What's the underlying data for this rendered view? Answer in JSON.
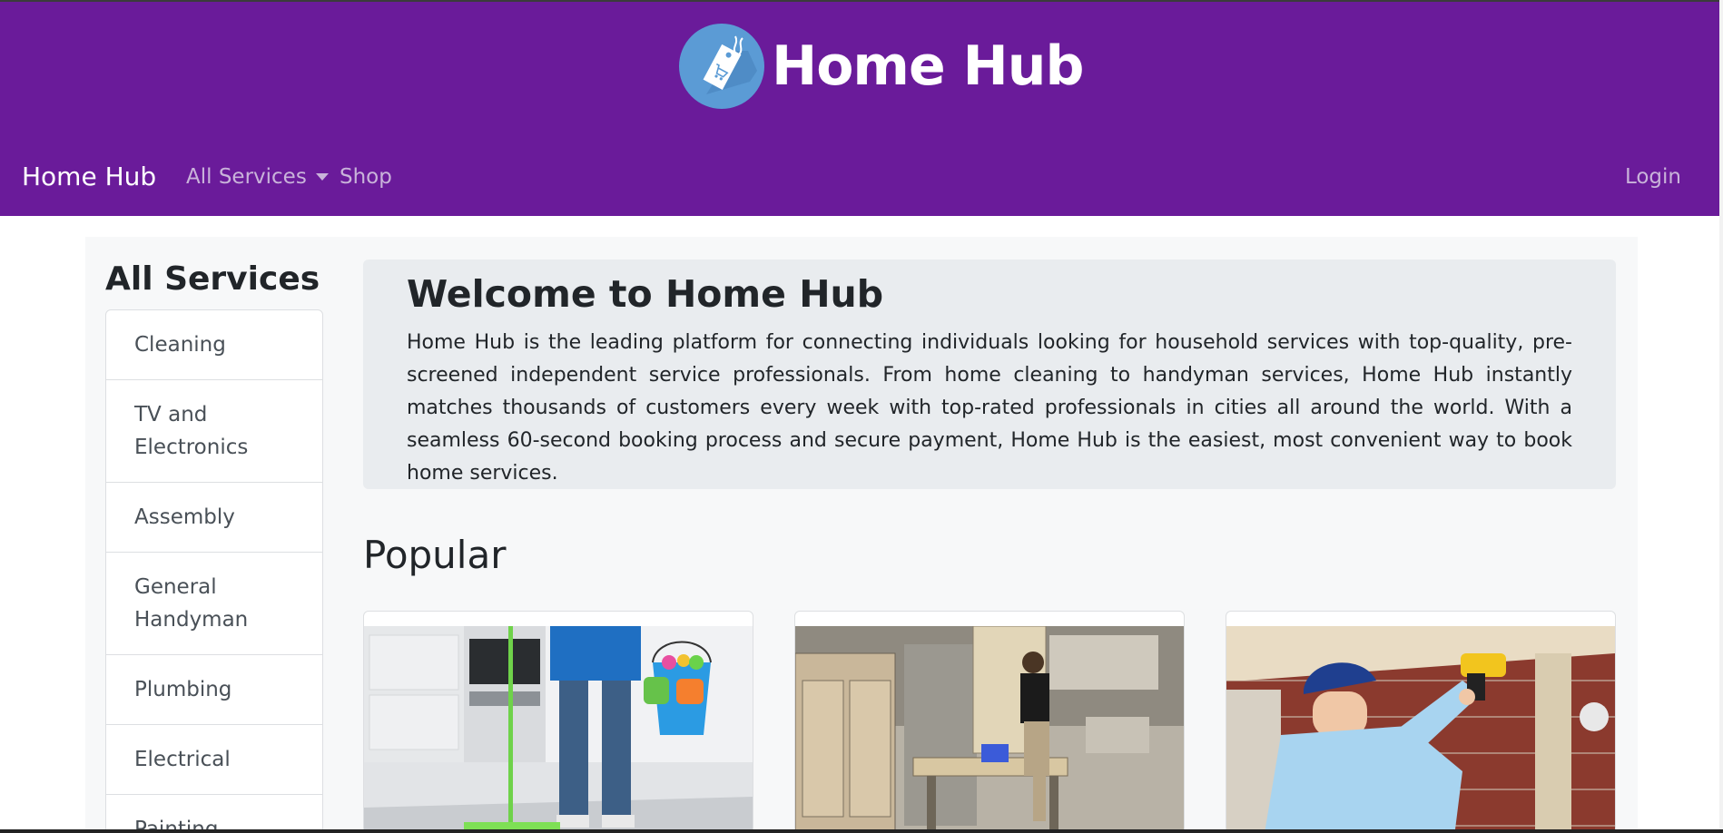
{
  "header": {
    "brand_title": "Home Hub",
    "logo_icon": "tag-cart-icon",
    "background_color": "#6a1b9a"
  },
  "navbar": {
    "brand": "Home Hub",
    "services_label": "All Services",
    "shop_label": "Shop",
    "login_label": "Login"
  },
  "sidebar": {
    "title": "All Services",
    "items": [
      {
        "label": "Cleaning"
      },
      {
        "label": "TV and Electronics"
      },
      {
        "label": "Assembly"
      },
      {
        "label": "General Handyman"
      },
      {
        "label": "Plumbing"
      },
      {
        "label": "Electrical"
      },
      {
        "label": "Painting"
      }
    ]
  },
  "welcome": {
    "title": "Welcome to Home Hub",
    "text": "Home Hub is the leading platform for connecting individuals looking for household services with top-quality, pre-screened independent service professionals. From home cleaning to handyman services, Home Hub instantly matches thousands of customers every week with top-rated professionals in cities all around the world. With a seamless 60-second booking process and secure payment, Home Hub is the easiest, most convenient way to book home services."
  },
  "popular": {
    "title": "Popular",
    "cards": [
      {
        "image": "cleaning-photo"
      },
      {
        "image": "workshop-photo"
      },
      {
        "image": "drill-photo"
      }
    ]
  }
}
